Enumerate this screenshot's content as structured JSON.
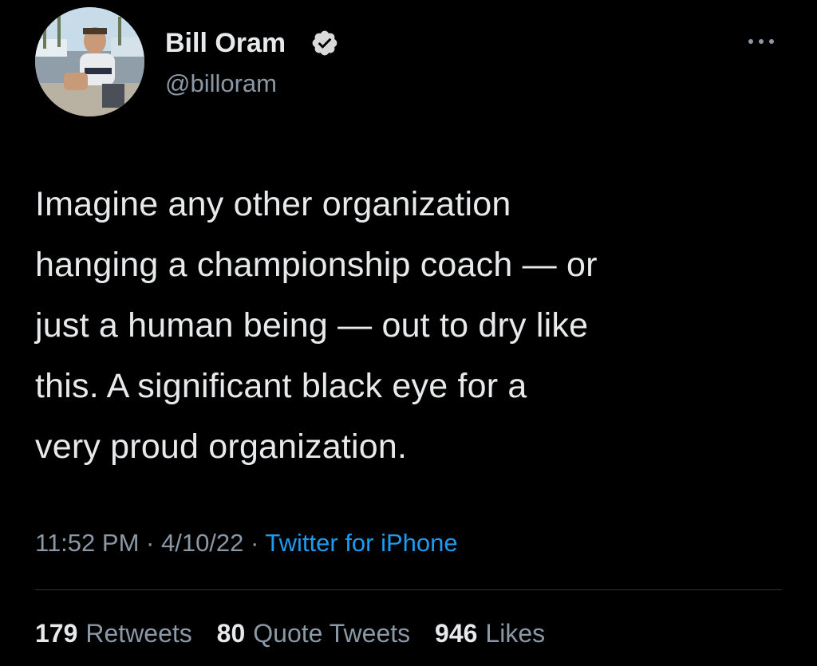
{
  "author": {
    "display_name": "Bill Oram",
    "handle": "@billoram",
    "verified_icon": "verified-badge-icon",
    "avatar_icon": "avatar-photo"
  },
  "more_icon": "more-options-icon",
  "tweet": {
    "lines": [
      "Imagine any other organization",
      "hanging a championship coach — or",
      "just a human being — out to dry like",
      "this. A significant black eye for a",
      "very proud organization."
    ]
  },
  "meta": {
    "time": "11:52 PM",
    "separator": "·",
    "date": "4/10/22",
    "source": "Twitter for iPhone"
  },
  "stats": {
    "retweets_count": "179",
    "retweets_label": "Retweets",
    "quotes_count": "80",
    "quotes_label": "Quote Tweets",
    "likes_count": "946",
    "likes_label": "Likes"
  },
  "colors": {
    "background": "#000000",
    "primary_text": "#e7e9ea",
    "secondary_text": "#8b98a5",
    "link": "#1d9bf0",
    "verified": "#d9d9d9"
  }
}
